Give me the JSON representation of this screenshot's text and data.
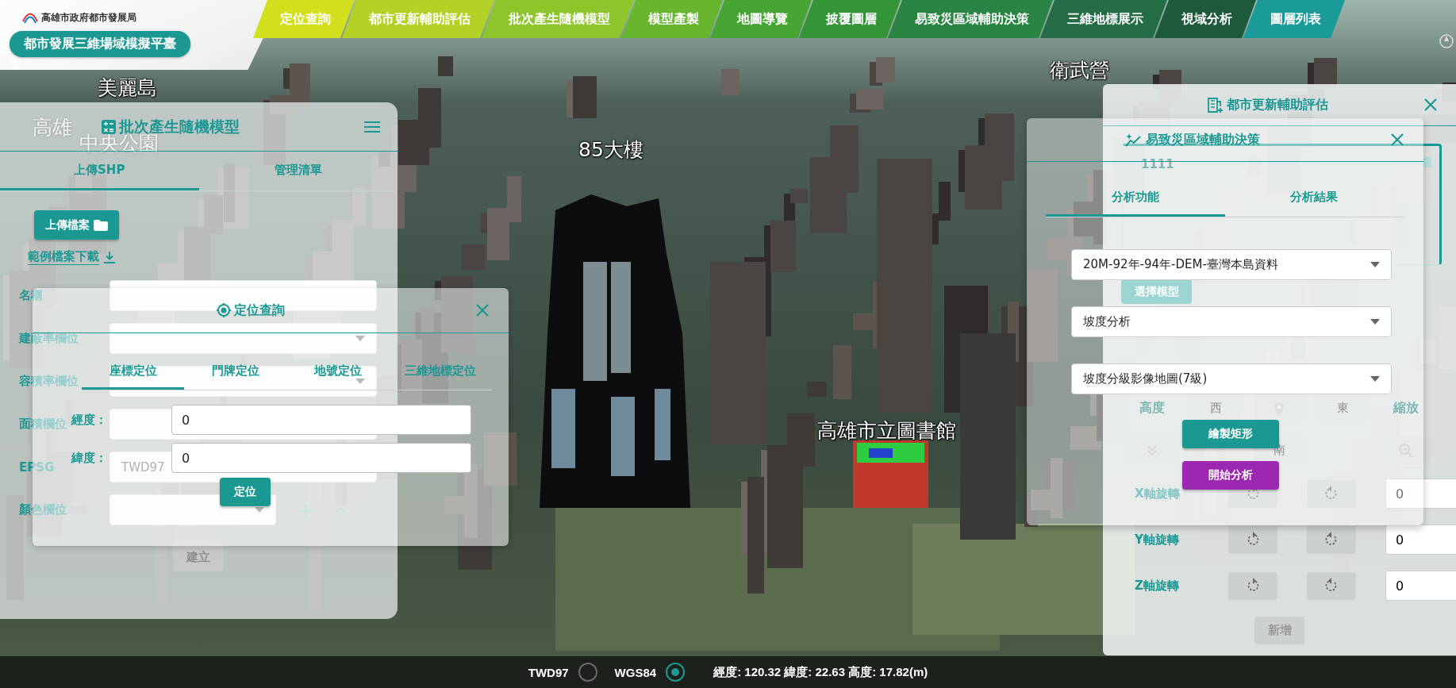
{
  "header": {
    "logo_text": "高雄市政府都市發展局",
    "platform_title": "都市發展三維場域模擬平臺"
  },
  "nav": [
    {
      "label": "定位查詢",
      "color": "#d2df1e"
    },
    {
      "label": "都市更新輔助評估",
      "color": "#b4d128"
    },
    {
      "label": "批次產生隨機模型",
      "color": "#8ec42c"
    },
    {
      "label": "模型產製",
      "color": "#68b52f"
    },
    {
      "label": "地圖導覽",
      "color": "#46a533"
    },
    {
      "label": "披覆圖層",
      "color": "#339538"
    },
    {
      "label": "易致災區域輔助決策",
      "color": "#2a8443"
    },
    {
      "label": "三維地標展示",
      "color": "#236c45"
    },
    {
      "label": "視域分析",
      "color": "#1d5a3c"
    },
    {
      "label": "圖層列表",
      "color": "#1b9a9a"
    }
  ],
  "map": {
    "labels": [
      "美麗島",
      "衛武營",
      "85大樓",
      "高雄",
      "中央公園",
      "高雄市立圖書館"
    ]
  },
  "batch_panel": {
    "title": "批次產生隨機模型",
    "tabs": [
      {
        "label": "上傳SHP",
        "selected": true
      },
      {
        "label": "管理清單",
        "selected": false
      }
    ],
    "upload_button": "上傳檔案",
    "sample_link": "範例檔案下載",
    "fields": [
      {
        "label": "名稱",
        "kind": "text"
      },
      {
        "label": "建蔽率欄位",
        "kind": "select"
      },
      {
        "label": "容積率欄位",
        "kind": "select"
      },
      {
        "label": "面積欄位",
        "kind": "text"
      },
      {
        "label": "EPSG",
        "kind": "select",
        "value": "TWD97"
      },
      {
        "label": "顏色欄位",
        "kind": "color"
      }
    ],
    "create_button": {
      "label": "建立",
      "disabled": true
    }
  },
  "locate_panel": {
    "title": "定位查詢",
    "tabs": [
      {
        "label": "座標定位",
        "selected": true
      },
      {
        "label": "門牌定位",
        "selected": false
      },
      {
        "label": "地號定位",
        "selected": false
      },
      {
        "label": "三維地標定位",
        "selected": false
      }
    ],
    "fields": [
      {
        "label": "經度：",
        "value": "0"
      },
      {
        "label": "緯度：",
        "value": "0"
      }
    ],
    "submit_button": "定位"
  },
  "renewal_panel": {
    "title": "都市更新輔助評估",
    "list_items": [
      "1111"
    ],
    "select_model_button": "選擇模型",
    "nav_pad": {
      "height_label": "高度",
      "west": "西",
      "east": "東",
      "south": "南",
      "zoom_label": "縮放"
    },
    "rotations": [
      {
        "label": "X軸旋轉",
        "value": "0"
      },
      {
        "label": "Y軸旋轉",
        "value": "0"
      },
      {
        "label": "Z軸旋轉",
        "value": "0"
      }
    ],
    "add_button": "新增"
  },
  "disaster_panel": {
    "title": "易致災區域輔助決策",
    "tabs": [
      {
        "label": "分析功能",
        "selected": true
      },
      {
        "label": "分析結果",
        "selected": false
      }
    ],
    "selects": [
      "20M-92年-94年-DEM-臺灣本島資料",
      "坡度分析",
      "坡度分級影像地圖(7級)"
    ],
    "draw_button": "繪製矩形",
    "analyze_button": "開始分析"
  },
  "status_bar": {
    "systems": [
      {
        "label": "TWD97",
        "selected": false
      },
      {
        "label": "WGS84",
        "selected": true
      }
    ],
    "coordinates": "經度: 120.32 緯度: 22.63 高度: 17.82(m)"
  }
}
